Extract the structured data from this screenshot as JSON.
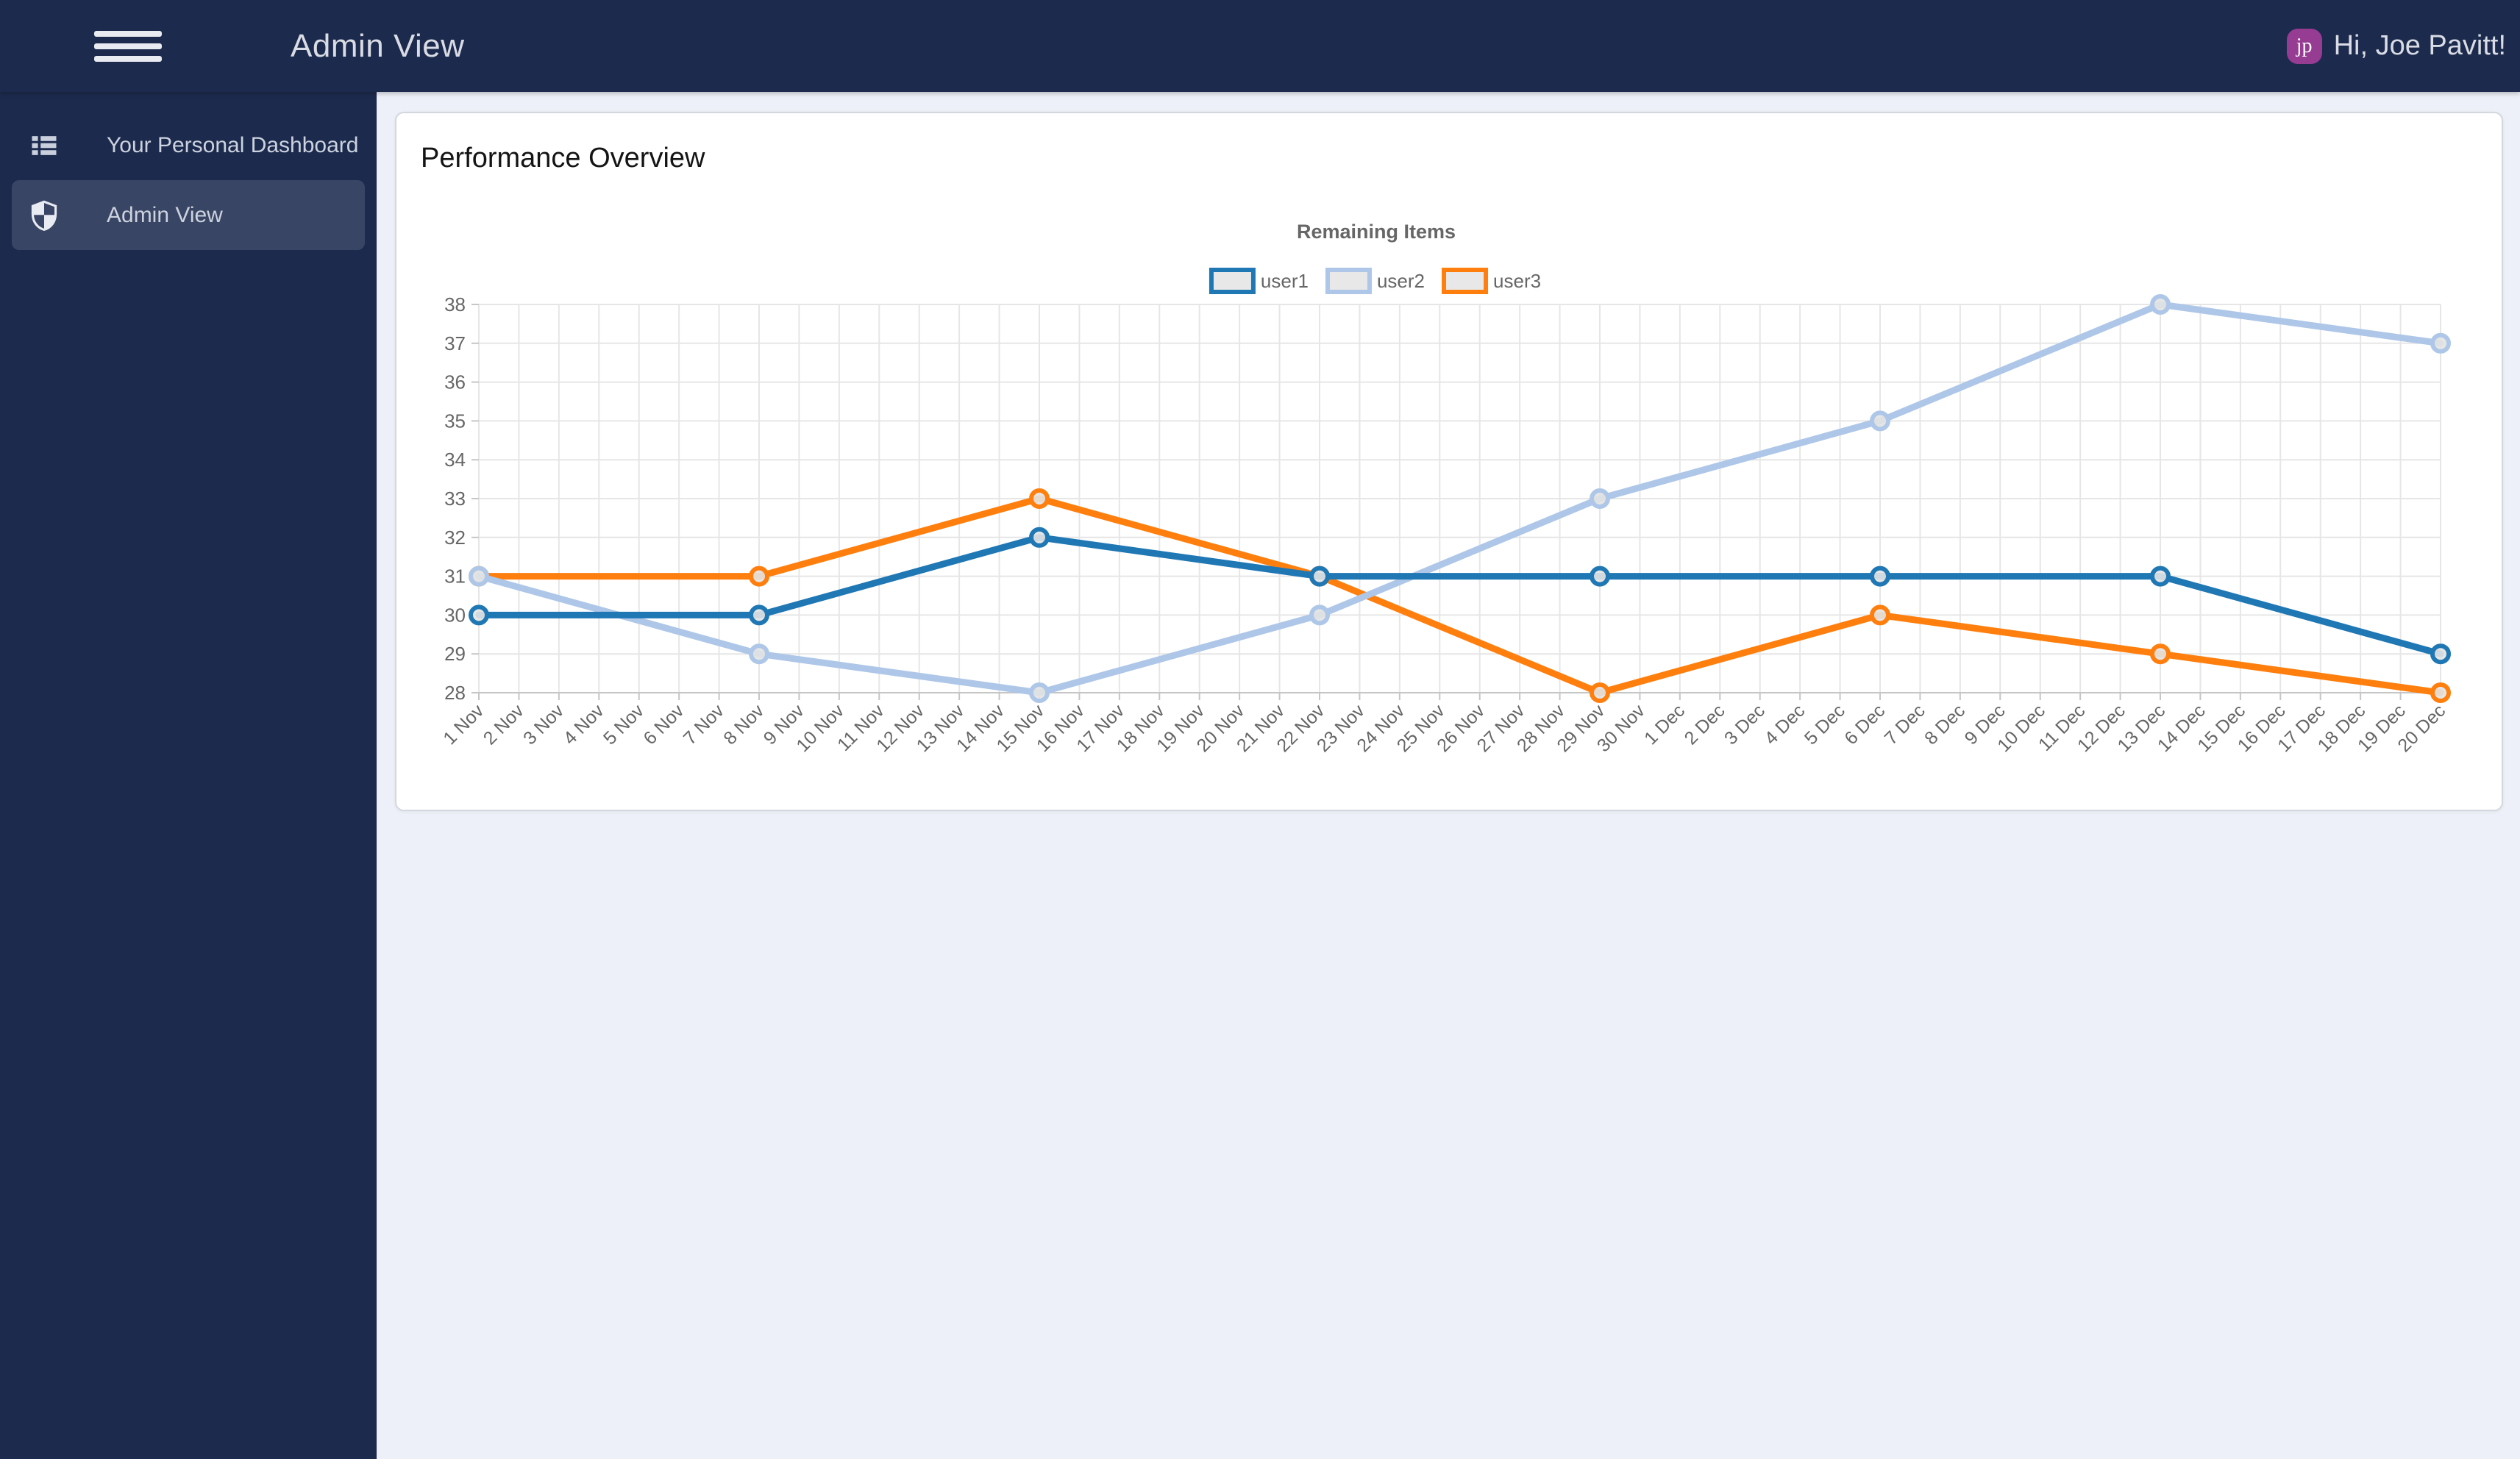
{
  "topbar": {
    "title": "Admin View",
    "greeting": "Hi, Joe Pavitt!",
    "avatar_initials": "jp"
  },
  "sidebar": {
    "items": [
      {
        "label": "Your Personal Dashboard",
        "icon": "list-icon",
        "active": false
      },
      {
        "label": "Admin View",
        "icon": "shield-icon",
        "active": true
      }
    ]
  },
  "card": {
    "title": "Performance Overview"
  },
  "chart_data": {
    "type": "line",
    "title": "Remaining Items",
    "categories": [
      "1 Nov",
      "2 Nov",
      "3 Nov",
      "4 Nov",
      "5 Nov",
      "6 Nov",
      "7 Nov",
      "8 Nov",
      "9 Nov",
      "10 Nov",
      "11 Nov",
      "12 Nov",
      "13 Nov",
      "14 Nov",
      "15 Nov",
      "16 Nov",
      "17 Nov",
      "18 Nov",
      "19 Nov",
      "20 Nov",
      "21 Nov",
      "22 Nov",
      "23 Nov",
      "24 Nov",
      "25 Nov",
      "26 Nov",
      "27 Nov",
      "28 Nov",
      "29 Nov",
      "30 Nov",
      "1 Dec",
      "2 Dec",
      "3 Dec",
      "4 Dec",
      "5 Dec",
      "6 Dec",
      "7 Dec",
      "8 Dec",
      "9 Dec",
      "10 Dec",
      "11 Dec",
      "12 Dec",
      "13 Dec",
      "14 Dec",
      "15 Dec",
      "16 Dec",
      "17 Dec",
      "18 Dec",
      "19 Dec",
      "20 Dec"
    ],
    "x_points": [
      "1 Nov",
      "8 Nov",
      "15 Nov",
      "22 Nov",
      "29 Nov",
      "6 Dec",
      "13 Dec",
      "20 Dec"
    ],
    "series": [
      {
        "name": "user1",
        "color": "#1f77b4",
        "values": [
          30,
          30,
          32,
          31,
          31,
          31,
          31,
          29
        ]
      },
      {
        "name": "user2",
        "color": "#aec7e8",
        "values": [
          31,
          29,
          28,
          30,
          33,
          35,
          38,
          37
        ]
      },
      {
        "name": "user3",
        "color": "#ff7f0e",
        "values": [
          31,
          31,
          33,
          31,
          28,
          30,
          29,
          28
        ]
      }
    ],
    "ylim": [
      28,
      38
    ],
    "y_ticks": [
      38,
      37,
      36,
      35,
      34,
      33,
      32,
      31,
      30,
      29,
      28
    ],
    "grid": true,
    "legend_position": "top",
    "legend_fill": "#e8e8e8"
  },
  "colors": {
    "topbar_bg": "#1c2a4d",
    "sidebar_bg": "#1c2a4d",
    "page_bg": "#edf0f8",
    "card_bg": "#ffffff",
    "card_border": "#d3d7de",
    "avatar_bg": "#963c93",
    "grid_color": "#e6e6e6",
    "axis_color": "#c6c6c6",
    "chart_text": "#666666",
    "series_user1": "#1f77b4",
    "series_user2": "#aec7e8",
    "series_user3": "#ff7f0e"
  }
}
